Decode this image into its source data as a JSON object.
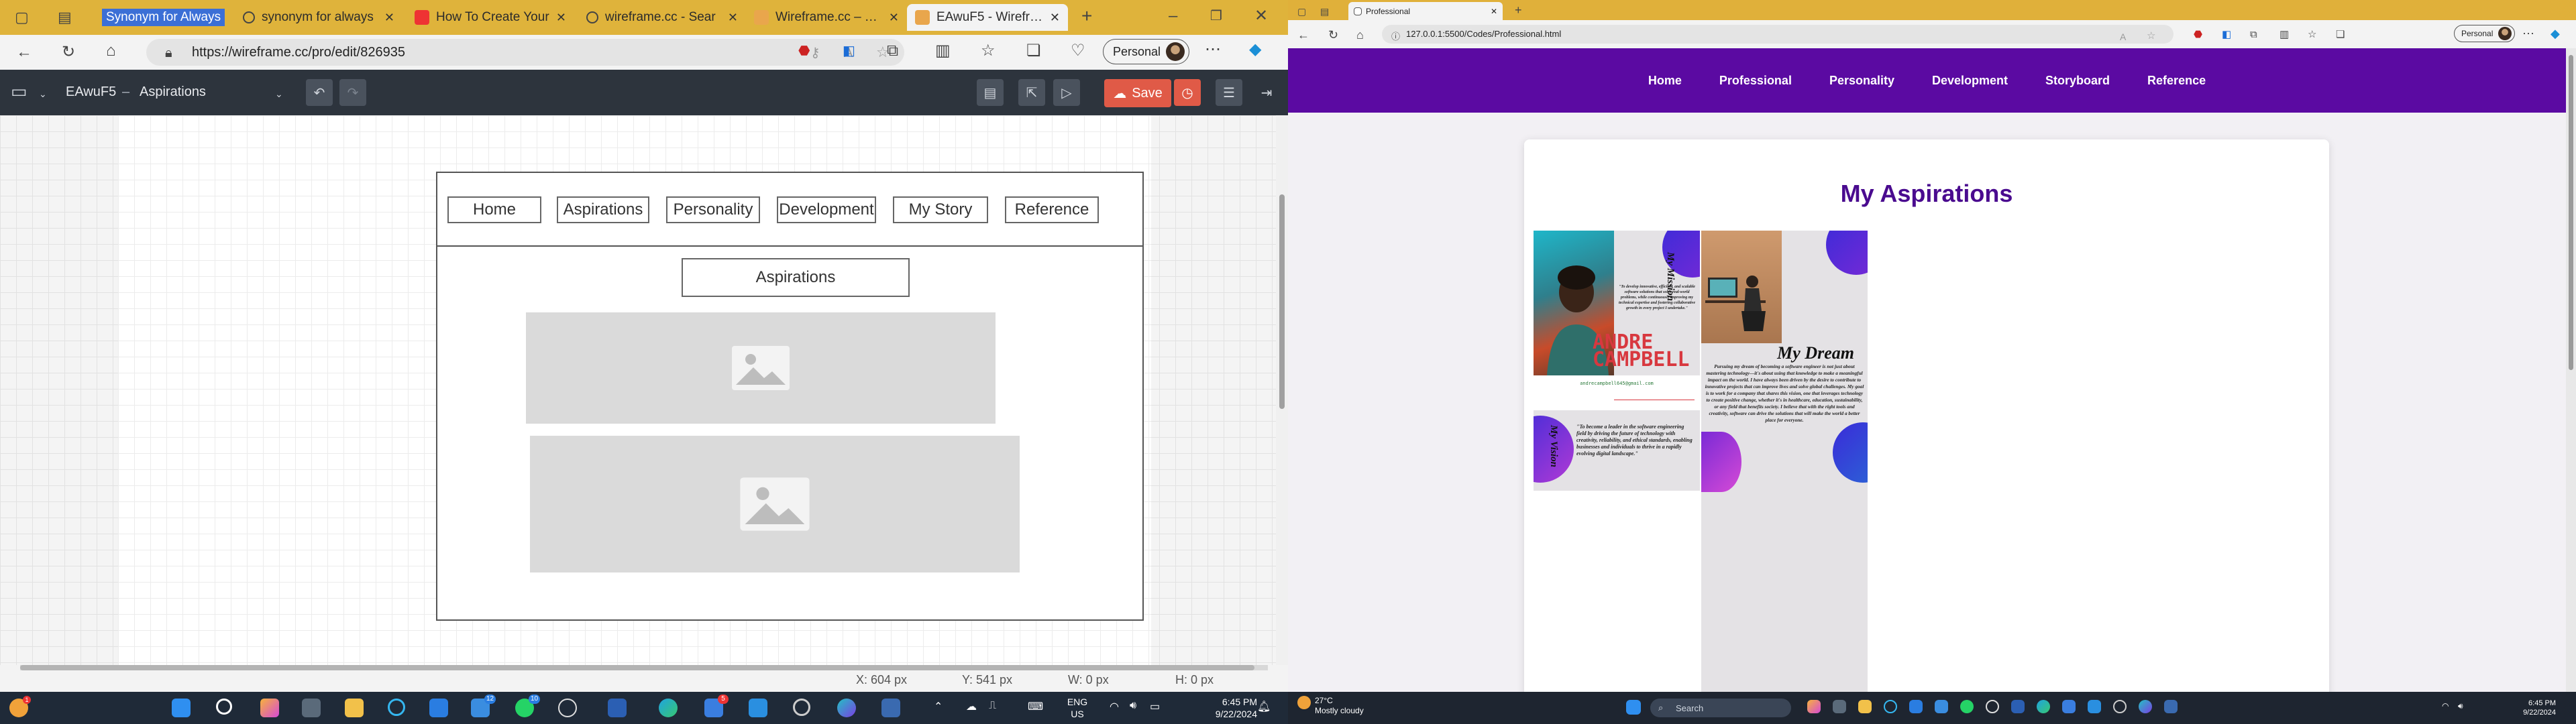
{
  "left_browser": {
    "tabs": [
      {
        "title": "Synonym for Always",
        "highlight": true
      },
      {
        "title": "synonym for always"
      },
      {
        "title": "How To Create Your"
      },
      {
        "title": "wireframe.cc - Sear"
      },
      {
        "title": "Wireframe.cc – The"
      },
      {
        "title": "EAwuF5 - Wirefram",
        "active": true
      }
    ],
    "url": "https://wireframe.cc/pro/edit/826935",
    "profile_label": "Personal",
    "app_toolbar": {
      "doc_id": "EAwuF5",
      "separator": "–",
      "page_name": "Aspirations",
      "save_label": "Save"
    },
    "wireframe": {
      "nav_items": [
        "Home",
        "Aspirations",
        "Personality",
        "Development",
        "My Story",
        "Reference"
      ],
      "heading": "Aspirations"
    },
    "status_bar": {
      "x": "X: 604 px",
      "y": "Y: 541 px",
      "w": "W: 0 px",
      "h": "H: 0 px"
    }
  },
  "right_browser": {
    "tab_title": "Professional",
    "url": "127.0.0.1:5500/Codes/Professional.html",
    "profile_label": "Personal",
    "site": {
      "nav_items": [
        "Home",
        "Professional",
        "Personality",
        "Development",
        "Storyboard",
        "Reference"
      ],
      "heading": "My Aspirations",
      "mission_label": "My Mission",
      "mission_text": "\"To develop innovative, efficient, and scalable software solutions that solve real-world problems, while continuously improving my technical expertise and fostering collaborative growth in every project I undertake.\"",
      "name_line1": "ANDRE",
      "name_line2": "CAMPBELL",
      "email": "andrecampbell645@gmail.com",
      "dream_title": "My Dream",
      "dream_text": "Pursuing my dream of becoming a software engineer is not just about mastering technology—it's about using that knowledge to make a meaningful impact on the world. I have always been driven by the desire to contribute to innovative projects that can improve lives and solve global challenges. My goal is to work for a company that shares this vision, one that leverages technology to create positive change, whether it's in healthcare, education, sustainability, or any field that benefits society. I believe that with the right tools and creativity, software can drive the solutions that will make the world a better place for everyone.",
      "vision_label": "My Vision",
      "vision_text": "\"To become a leader in the software engineering field by driving the future of technology with creativity, reliability, and ethical standards, enabling businesses and individuals to thrive in a rapidly evolving digital landscape.\""
    }
  },
  "left_taskbar": {
    "lang": "ENG",
    "region": "US",
    "time": "6:45 PM",
    "date": "9/22/2024",
    "badges": [
      "12",
      "10",
      "5",
      "1"
    ]
  },
  "right_taskbar": {
    "weather_temp": "27°C",
    "weather_desc": "Mostly cloudy",
    "search_placeholder": "Search",
    "time": "6:45 PM",
    "date": "9/22/2024"
  },
  "colors": {
    "tab_strip": "#dfb33b",
    "wf_toolbar": "#2d343d",
    "save": "#e05a47",
    "site_nav": "#5b0aa2",
    "site_heading": "#4a0b8f",
    "name_red": "#d8383f",
    "taskbar": "#1f2a38"
  }
}
